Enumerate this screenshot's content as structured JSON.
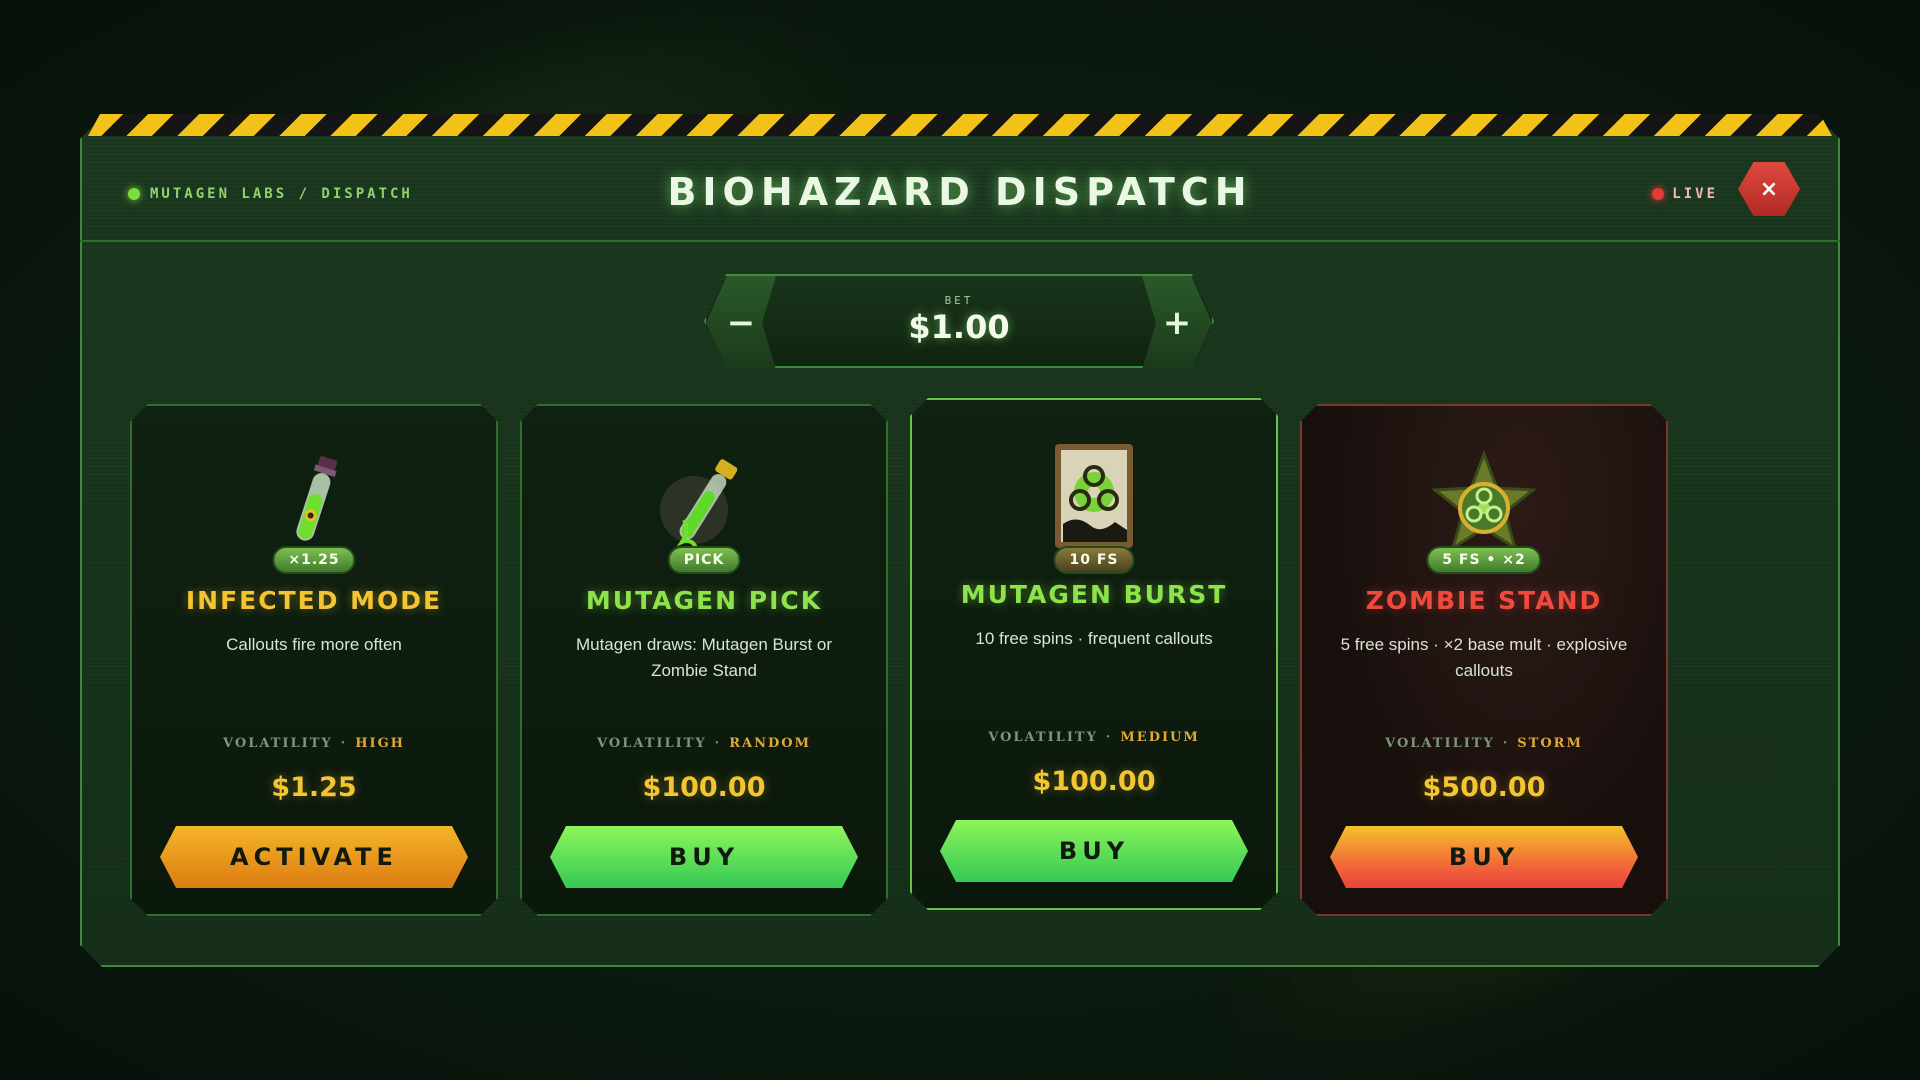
{
  "header": {
    "breadcrumb": "MUTAGEN LABS / DISPATCH",
    "title": "BIOHAZARD DISPATCH",
    "live": "LIVE",
    "close": "×"
  },
  "bet": {
    "label": "BET",
    "value": "$1.00",
    "minus": "−",
    "plus": "+"
  },
  "cards": [
    {
      "icon": "infected-vial-icon",
      "badge": "×1.25",
      "title": "INFECTED MODE",
      "description": "Callouts fire more often",
      "volatility_label": "VOLATILITY",
      "volatility_sep": "·",
      "volatility": "HIGH",
      "price": "$1.25",
      "cta": "ACTIVATE",
      "accent": "#f5c531"
    },
    {
      "icon": "mutagen-syringe-icon",
      "badge": "PICK",
      "title": "MUTAGEN PICK",
      "description": "Mutagen draws: Mutagen Burst or Zombie Stand",
      "volatility_label": "VOLATILITY",
      "volatility_sep": "·",
      "volatility": "RANDOM",
      "price": "$100.00",
      "cta": "BUY",
      "accent": "#8ee34b"
    },
    {
      "icon": "biohazard-poster-icon",
      "badge": "10 FS",
      "title": "MUTAGEN BURST",
      "description": "10 free spins · frequent callouts",
      "volatility_label": "VOLATILITY",
      "volatility_sep": "·",
      "volatility": "MEDIUM",
      "price": "$100.00",
      "cta": "BUY",
      "accent": "#8ee34b"
    },
    {
      "icon": "biohazard-sheriff-star-icon",
      "badge": "5 FS • ×2",
      "title": "ZOMBIE STAND",
      "description": "5 free spins · ×2 base mult · explosive callouts",
      "volatility_label": "VOLATILITY",
      "volatility_sep": "·",
      "volatility": "STORM",
      "price": "$500.00",
      "cta": "BUY",
      "accent": "#f04a3d"
    }
  ]
}
